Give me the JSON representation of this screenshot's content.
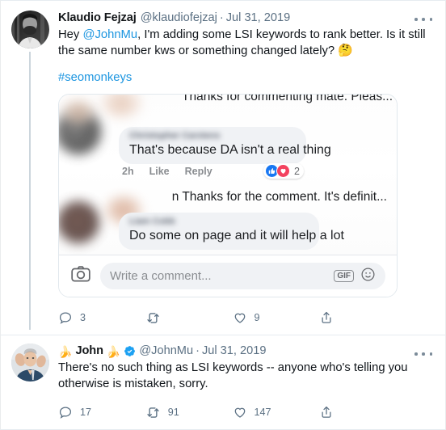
{
  "theme": {
    "link_blue": "#1b95e0",
    "verified_blue": "#1da1f2",
    "text_primary": "#0f1419",
    "text_muted": "#5b7083",
    "card_bg": "#ffffff",
    "page_bg": "#f2f3f4",
    "fb_like_blue": "#1877f2",
    "fb_love_red": "#f3425f"
  },
  "tweets": [
    {
      "display_name": "Klaudio Fejzaj",
      "handle": "@klaudiofejzaj",
      "separator": "·",
      "date": "Jul 31, 2019",
      "verified": false,
      "avatar": "klaudio-avatar",
      "text_before_mention": "Hey ",
      "mention": "@JohnMu",
      "text_after_mention": ", I'm adding some LSI keywords to rank better. Is it still the same number kws or something changed lately? ",
      "trailing_emoji": "🤔",
      "hashtag": "#seomonkeys",
      "more_label": "More",
      "actions": {
        "reply_count": "3",
        "retweet_count": "",
        "like_count": "9",
        "share_label": "Share"
      },
      "embed": {
        "alt": "facebook-comments-screenshot",
        "truncated_top": "Thanks for commenting mate. Pleas...",
        "comments": [
          {
            "author": "Christopher Carstens",
            "text": "That's because DA isn't a real thing",
            "time": "2h",
            "like_label": "Like",
            "reply_label": "Reply",
            "reaction_count": "2"
          },
          {
            "author": "",
            "text": "Thanks for the comment. It's definit...",
            "mention_fragment": "n"
          },
          {
            "author": "Liam Cobb",
            "text": "Do some on page and it will help a lot"
          }
        ],
        "composer": {
          "placeholder": "Write a comment...",
          "camera_icon": "camera-icon",
          "gif_label": "GIF",
          "emoji_icon": "smiley-icon"
        }
      }
    },
    {
      "display_name": "John",
      "name_emoji_left": "🍌",
      "name_emoji_right": "🍌",
      "handle": "@JohnMu",
      "separator": "·",
      "date": "Jul 31, 2019",
      "verified": true,
      "avatar": "johnmu-avatar",
      "text": "There's no such thing as LSI keywords -- anyone who's telling you otherwise is mistaken, sorry.",
      "more_label": "More",
      "actions": {
        "reply_count": "17",
        "retweet_count": "91",
        "like_count": "147",
        "share_label": "Share"
      }
    }
  ]
}
